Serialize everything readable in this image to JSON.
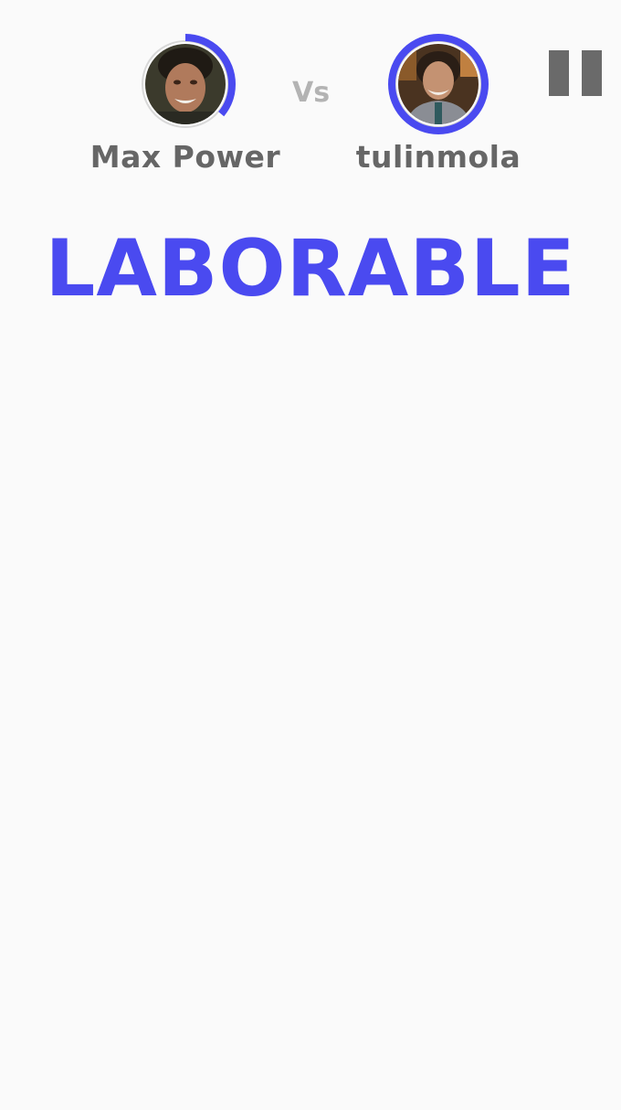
{
  "players": [
    {
      "name": "Max Power",
      "timer_fraction": 0.36
    },
    {
      "name": "tulinmola",
      "timer_fraction": 1.0
    }
  ],
  "vs_label": "Vs",
  "word": "LABORABLE",
  "colors": {
    "accent": "#4a4af0",
    "name_text": "#666666",
    "vs_text": "#b3b3b3",
    "pause": "#6a6a6a",
    "background": "#fafafa"
  },
  "icons": {
    "pause": "pause-icon"
  }
}
